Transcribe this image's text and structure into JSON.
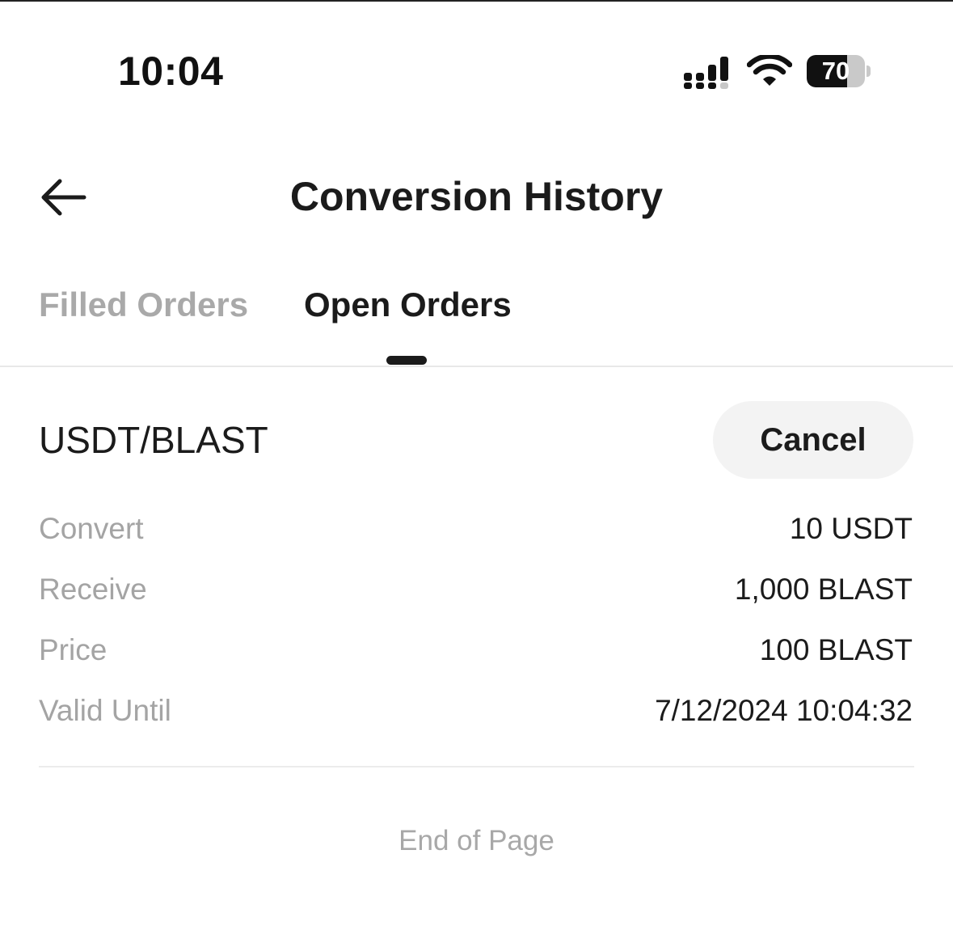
{
  "status_bar": {
    "time": "10:04",
    "battery_level": "70",
    "battery_fraction": 0.7,
    "icons": [
      "signal-icon",
      "wifi-icon",
      "battery-icon"
    ]
  },
  "header": {
    "title": "Conversion History",
    "back_icon": "back-arrow-icon"
  },
  "tabs": [
    {
      "label": "Filled Orders",
      "active": false
    },
    {
      "label": "Open Orders",
      "active": true
    }
  ],
  "order": {
    "pair": "USDT/BLAST",
    "cancel_label": "Cancel",
    "rows": [
      {
        "label": "Convert",
        "value": "10 USDT"
      },
      {
        "label": "Receive",
        "value": "1,000 BLAST"
      },
      {
        "label": "Price",
        "value": "100 BLAST"
      },
      {
        "label": "Valid Until",
        "value": "7/12/2024 10:04:32"
      }
    ]
  },
  "footer": {
    "end_text": "End of Page"
  },
  "colors": {
    "text_primary": "#1b1b1b",
    "text_secondary": "#a4a4a4",
    "button_bg": "#f3f3f3",
    "divider": "#e8e8e8"
  }
}
